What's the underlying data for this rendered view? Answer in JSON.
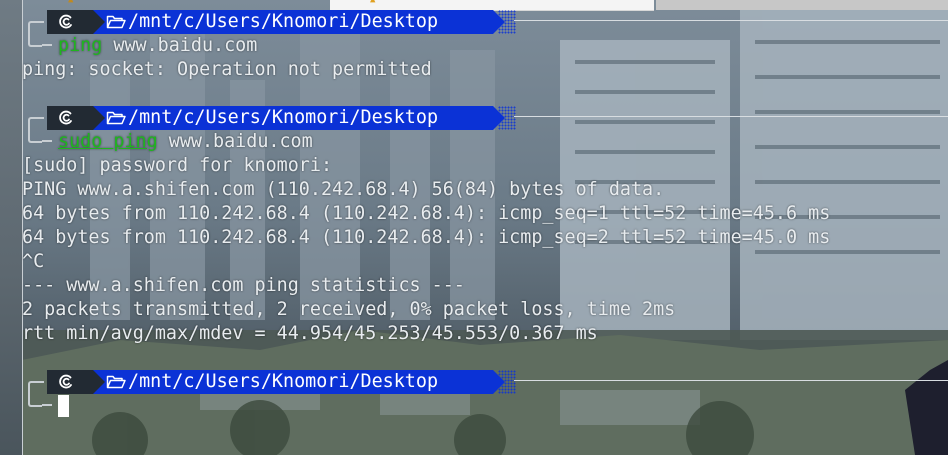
{
  "terminal": {
    "prompt_path": "/mnt/c/Users/Knomori/Desktop",
    "os_icon": "debian-swirl-icon",
    "folder_icon": "folder-open-icon",
    "blocks": [
      {
        "command": {
          "program": "ping",
          "args": " www.baidu.com"
        },
        "output": [
          "ping: socket: Operation not permitted"
        ]
      },
      {
        "command": {
          "sudo": "sudo",
          "program": "ping",
          "args": " www.baidu.com"
        },
        "output": [
          "[sudo] password for knomori:",
          "PING www.a.shifen.com (110.242.68.4) 56(84) bytes of data.",
          "64 bytes from 110.242.68.4 (110.242.68.4): icmp_seq=1 ttl=52 time=45.6 ms",
          "64 bytes from 110.242.68.4 (110.242.68.4): icmp_seq=2 ttl=52 time=45.0 ms",
          "^C",
          "--- www.a.shifen.com ping statistics ---",
          "2 packets transmitted, 2 received, 0% packet loss, time 2ms",
          "rtt min/avg/max/mdev = 44.954/45.253/45.553/0.367 ms"
        ]
      }
    ]
  },
  "colors": {
    "prompt_dir_bg": "#0b32d6",
    "prompt_os_bg": "#222a33",
    "command_green": "#1fb51f",
    "text": "#e8ecef"
  }
}
